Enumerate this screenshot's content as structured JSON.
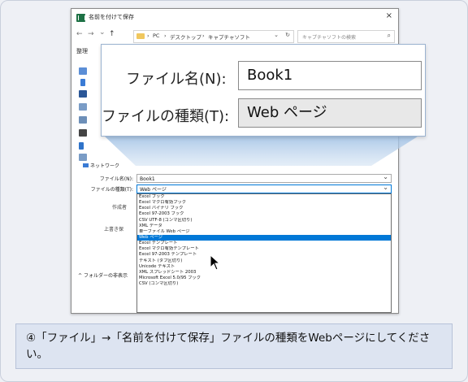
{
  "dialog": {
    "title": "名前を付けて保存",
    "close_glyph": "×"
  },
  "navigation": {
    "back": "←",
    "forward": "→",
    "menu": "⌄",
    "up": "↑",
    "breadcrumbs": [
      "PC",
      "デスクトップ",
      "キャプチャソフト"
    ],
    "separator": "›",
    "search_placeholder": "キャプチャソフトの検索",
    "refresh": "↻"
  },
  "sidebar": {
    "organize": "整理",
    "network": "ネットワーク",
    "hide_folders": "フォルダーの非表示"
  },
  "form": {
    "filename_label": "ファイル名(N):",
    "filename_value": "Book1",
    "filetype_label": "ファイルの種類(T):",
    "filetype_value": "Web ページ",
    "author_label": "作成者",
    "overwrite_label": "上書き保"
  },
  "filetype_options": [
    "Excel ブック",
    "Excel マクロ有効ブック",
    "Excel バイナリ ブック",
    "Excel 97-2003 ブック",
    "CSV UTF-8 (コンマ区切り)",
    "XML データ",
    "単一ファイル Web ページ",
    "Web ページ",
    "Excel テンプレート",
    "Excel マクロ有効テンプレート",
    "Excel 97-2003 テンプレート",
    "テキスト (タブ区切り)",
    "Unicode テキスト",
    "XML スプレッドシート 2003",
    "Microsoft Excel 5.0/95 ブック",
    "CSV (コンマ区切り)"
  ],
  "selected_option_index": 7,
  "zoom": {
    "filename_label": "ファイル名(N):",
    "filename_value": "Book1",
    "filetype_label": "ファイルの種類(T):",
    "filetype_value": "Web ページ"
  },
  "instruction": {
    "text": "④「ファイル」→「名前を付けて保存」ファイルの種類をWebページにしてください。"
  },
  "colors": {
    "selection": "#0078d7",
    "banner": "#dde4f1",
    "excel_green": "#1e7145"
  }
}
